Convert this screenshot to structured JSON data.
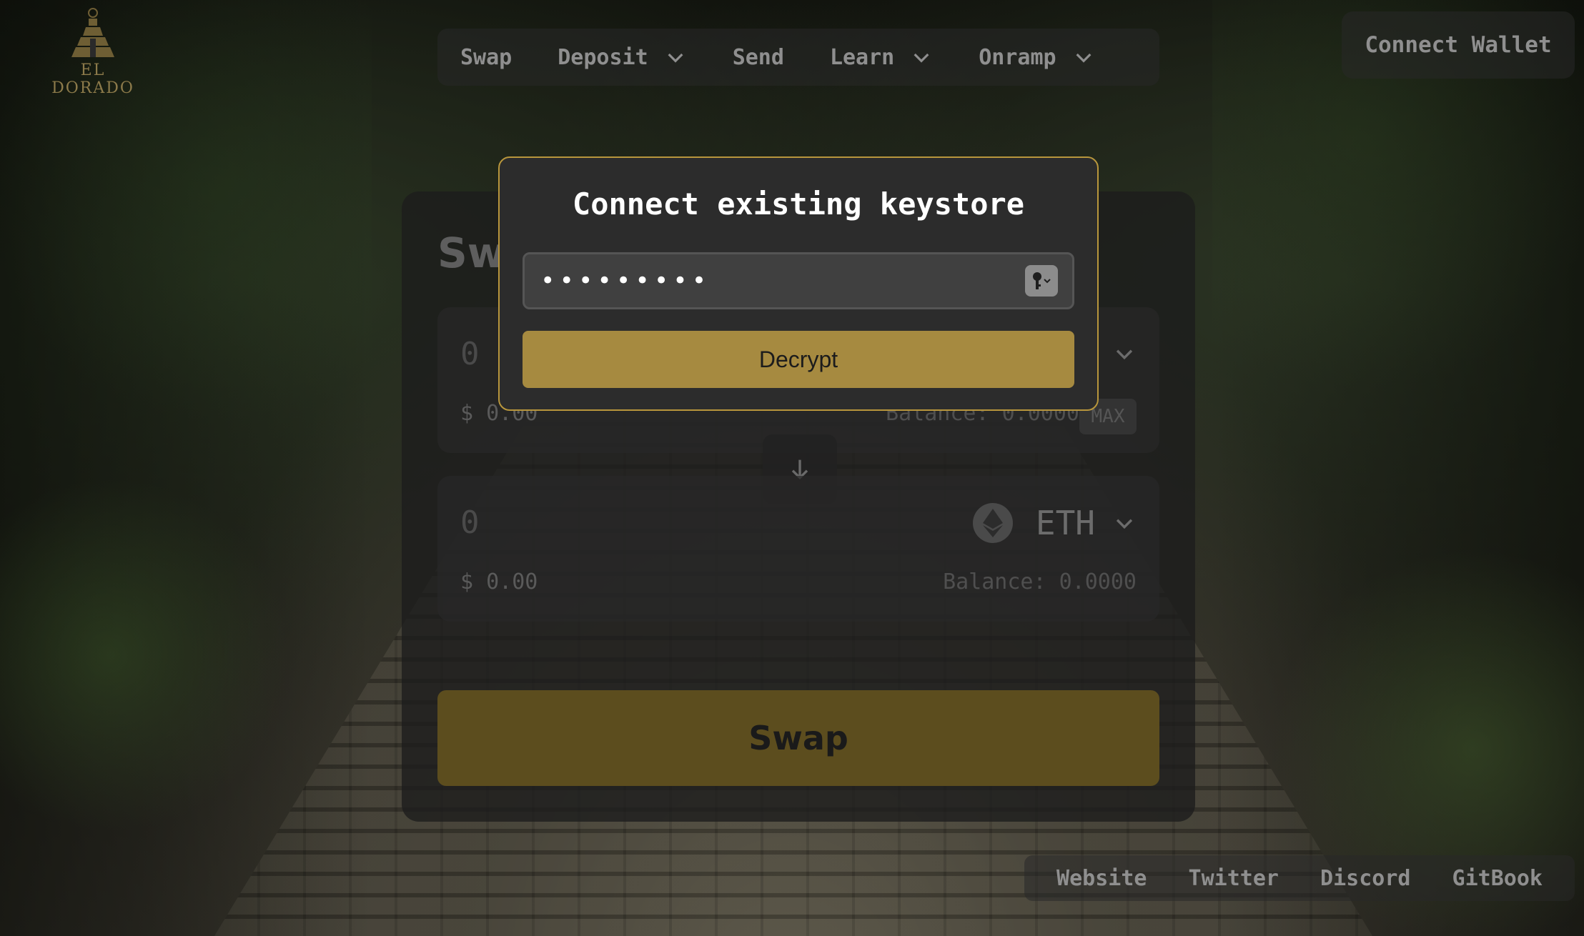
{
  "brand": {
    "logo_text": "EL DORADO"
  },
  "nav": {
    "items": [
      {
        "label": "Swap",
        "has_dropdown": false
      },
      {
        "label": "Deposit",
        "has_dropdown": true
      },
      {
        "label": "Send",
        "has_dropdown": false
      },
      {
        "label": "Learn",
        "has_dropdown": true
      },
      {
        "label": "Onramp",
        "has_dropdown": true
      }
    ],
    "connect_wallet_label": "Connect Wallet"
  },
  "swap_card": {
    "title": "Swap",
    "from": {
      "amount": "0",
      "usd": "$ 0.00",
      "balance": "Balance: 0.0000",
      "max_label": "MAX"
    },
    "to": {
      "amount": "0",
      "usd": "$ 0.00",
      "balance": "Balance: 0.0000",
      "token": "ETH",
      "token_icon": "ethereum-icon"
    },
    "submit_label": "Swap"
  },
  "modal": {
    "title": "Connect existing keystore",
    "password_value": "•••••••••",
    "decrypt_label": "Decrypt",
    "key_icon": "key-icon"
  },
  "footer": {
    "links": [
      "Website",
      "Twitter",
      "Discord",
      "GitBook"
    ]
  },
  "colors": {
    "accent": "#a68a40",
    "modal_border": "#b8963c",
    "swap_button_dim": "#5c4d1e"
  }
}
